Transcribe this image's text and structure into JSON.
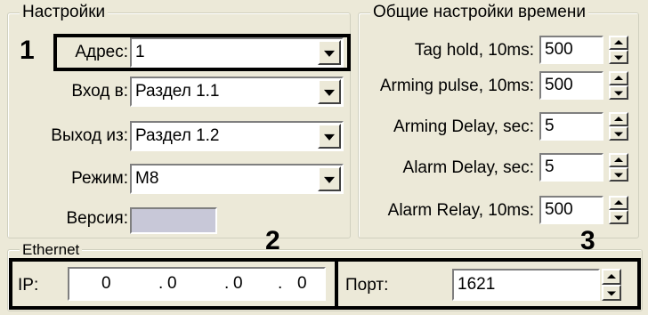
{
  "settings": {
    "title": "Настройки",
    "address": {
      "label": "Адрес:",
      "value": "1"
    },
    "input": {
      "label": "Вход в:",
      "value": "Раздел 1.1"
    },
    "output": {
      "label": "Выход из:",
      "value": "Раздел 1.2"
    },
    "mode": {
      "label": "Режим:",
      "value": "M8"
    },
    "version": {
      "label": "Версия:",
      "value": ""
    }
  },
  "time_settings": {
    "title": "Общие настройки времени",
    "fields": [
      {
        "label": "Tag hold, 10ms:",
        "value": "500"
      },
      {
        "label": "Arming pulse, 10ms:",
        "value": "500"
      },
      {
        "label": "Arming Delay, sec:",
        "value": "5"
      },
      {
        "label": "Alarm Delay, sec:",
        "value": "5"
      },
      {
        "label": "Alarm Relay, 10ms:",
        "value": "500"
      }
    ]
  },
  "ethernet": {
    "title": "Ethernet",
    "ip_label": "IP:",
    "ip_octets": [
      "0",
      "0",
      "0",
      "0"
    ],
    "ip_dot": ".",
    "port_label": "Порт:",
    "port_value": "1621"
  },
  "annotations": [
    "1",
    "2",
    "3"
  ]
}
